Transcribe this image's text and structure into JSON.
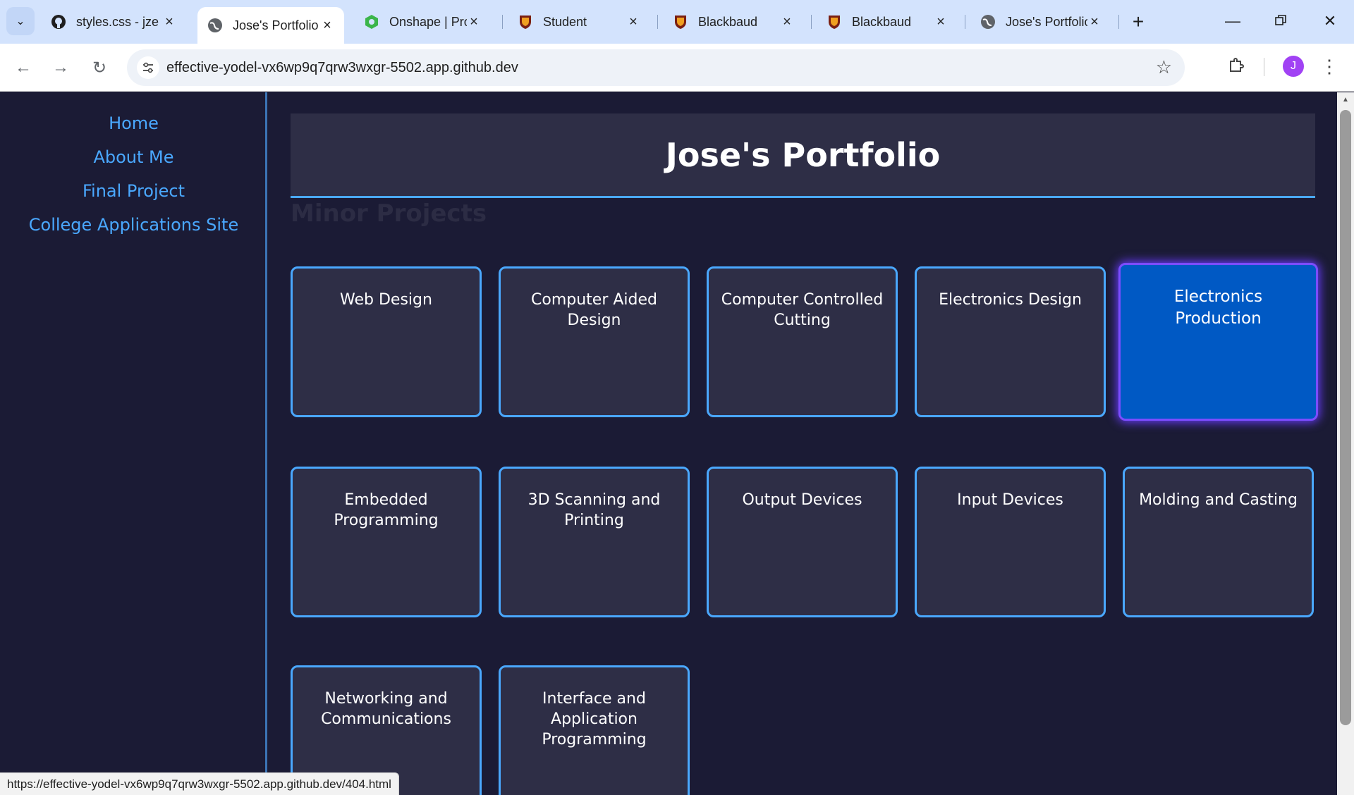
{
  "browser": {
    "tabs": [
      {
        "title": "styles.css - jze",
        "icon": "github-icon",
        "active": false
      },
      {
        "title": "Jose's Portfolio",
        "icon": "globe-icon",
        "active": true
      },
      {
        "title": "Onshape | Pro",
        "icon": "onshape-icon",
        "active": false
      },
      {
        "title": "Student",
        "icon": "shield-icon",
        "active": false
      },
      {
        "title": "Blackbaud",
        "icon": "shield-icon",
        "active": false
      },
      {
        "title": "Blackbaud",
        "icon": "shield-icon",
        "active": false
      },
      {
        "title": "Jose's Portfolio",
        "icon": "globe-icon",
        "active": false
      }
    ],
    "new_tab": "+",
    "url": "effective-yodel-vx6wp9q7qrw3wxgr-5502.app.github.dev",
    "avatar_letter": "J",
    "status_url": "https://effective-yodel-vx6wp9q7qrw3wxgr-5502.app.github.dev/404.html"
  },
  "sidebar": {
    "links": [
      "Home",
      "About Me",
      "Final Project",
      "College Applications Site"
    ]
  },
  "header": {
    "title": "Jose's Portfolio"
  },
  "section": {
    "title": "Minor Projects"
  },
  "projects": [
    "Web Design",
    "Computer Aided Design",
    "Computer Controlled Cutting",
    "Electronics Design",
    "Electronics Production",
    "Embedded Programming",
    "3D Scanning and Printing",
    "Output Devices",
    "Input Devices",
    "Molding and Casting",
    "Networking and Communications",
    "Interface and Application Programming"
  ],
  "hovered_project": "Electronics Production",
  "colors": {
    "page_bg": "#1b1b35",
    "card_bg": "#2e2e46",
    "accent": "#4aa8ff",
    "hover_bg": "#0059c4",
    "hover_border": "#7c4dff"
  }
}
